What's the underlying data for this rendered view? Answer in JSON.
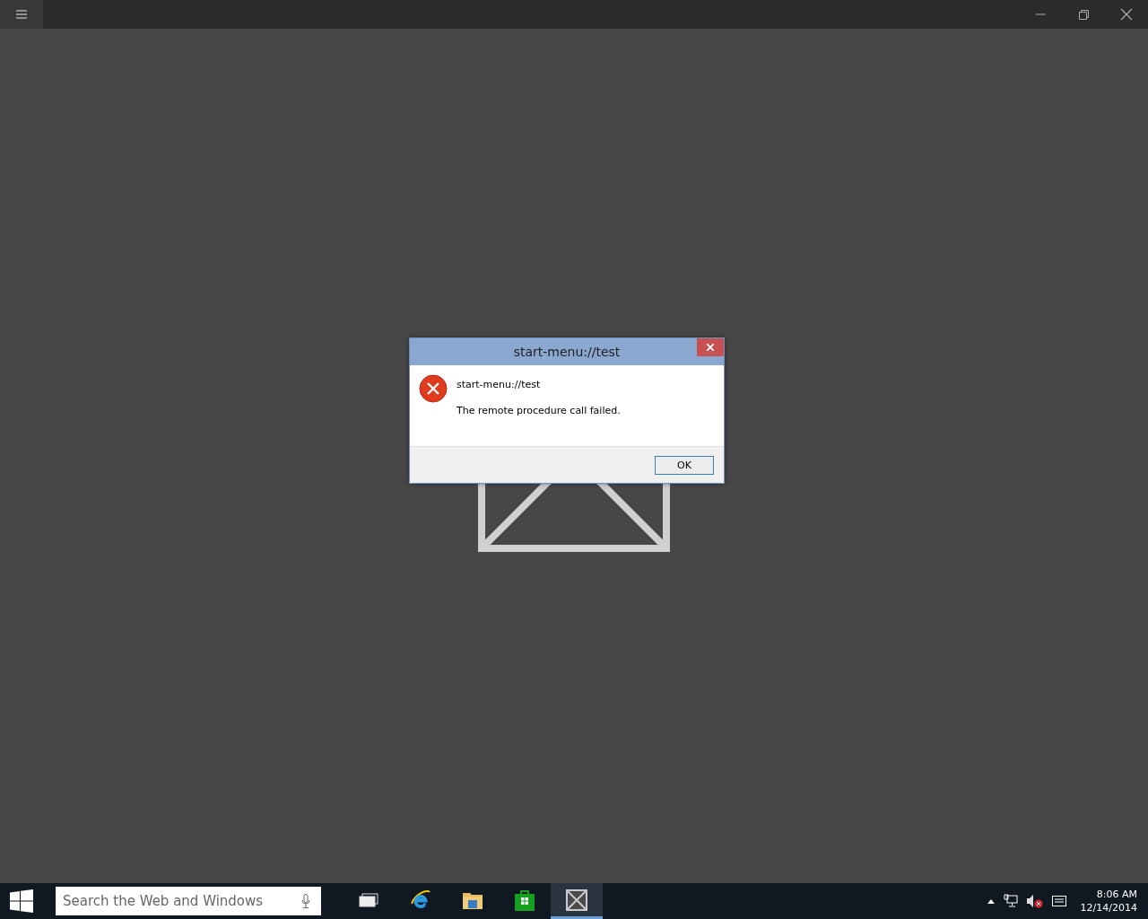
{
  "dialog": {
    "title": "start-menu://test",
    "heading": "start-menu://test",
    "message": "The remote procedure call failed.",
    "buttons": [
      "OK"
    ]
  },
  "taskbar": {
    "search": {
      "placeholder": "Search the Web and Windows"
    },
    "apps": [
      {
        "kind": "taskview",
        "selected": false
      },
      {
        "kind": "browser",
        "selected": false
      },
      {
        "kind": "folder",
        "selected": false
      },
      {
        "kind": "store",
        "selected": false
      },
      {
        "kind": "app",
        "selected": true
      }
    ],
    "clock": {
      "time": "8:06 AM",
      "date": "12/14/2014"
    }
  }
}
